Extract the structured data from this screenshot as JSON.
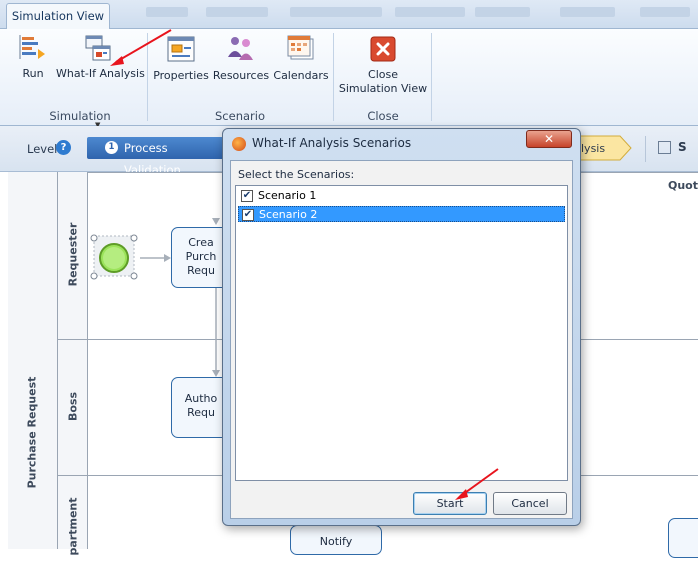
{
  "ribbon": {
    "active_tab": "Simulation View",
    "groups": {
      "simulation": "Simulation",
      "scenario": "Scenario",
      "close": "Close"
    },
    "buttons": {
      "run": "Run",
      "what_if": "What-If Analysis",
      "properties": "Properties",
      "resources": "Resources",
      "calendars": "Calendars",
      "close_line1": "Close",
      "close_line2": "Simulation View"
    }
  },
  "level_bar": {
    "level_label": "Level",
    "help": "?",
    "process_validation": {
      "number": "1",
      "label": "Process Validation"
    },
    "scenario_analysis": "lysis",
    "right_label": "S"
  },
  "diagram": {
    "pool": "Purchase Request",
    "lanes": [
      "Requester",
      "Boss",
      "partment"
    ],
    "quota": "Quota",
    "tasks": {
      "create": [
        "Crea",
        "Purch",
        "Requ"
      ],
      "authorize": [
        "Autho",
        "Requ"
      ],
      "notify": "Notify"
    }
  },
  "dialog": {
    "title": "What-If Analysis Scenarios",
    "close_glyph": "✕",
    "prompt": "Select the Scenarios:",
    "scenarios": [
      {
        "label": "Scenario 1",
        "checked": true,
        "selected": false
      },
      {
        "label": "Scenario 2",
        "checked": true,
        "selected": true
      }
    ],
    "check_glyph": "✔",
    "start": "Start",
    "cancel": "Cancel"
  },
  "colors": {
    "accent": "#2f64ad",
    "selection": "#3399ff",
    "annotation_arrow": "#e8141d",
    "close_button": "#c7432a",
    "start_event": "#7ed321"
  }
}
